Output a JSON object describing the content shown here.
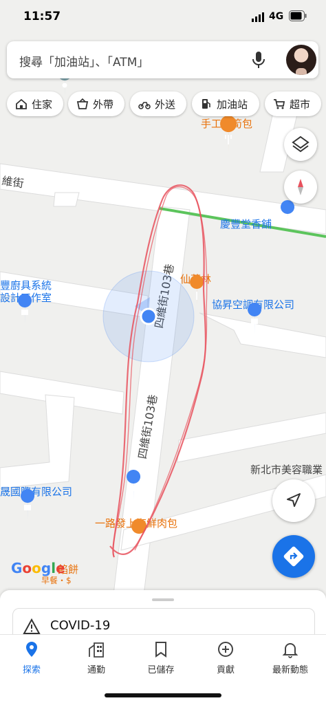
{
  "status_bar": {
    "time": "11:57",
    "network": "4G"
  },
  "search": {
    "placeholder": "搜尋「加油站」、「ATM」"
  },
  "chips": [
    {
      "label": "住家",
      "icon": "home-icon"
    },
    {
      "label": "外帶",
      "icon": "takeout-icon"
    },
    {
      "label": "外送",
      "icon": "delivery-icon"
    },
    {
      "label": "加油站",
      "icon": "gas-station-icon"
    },
    {
      "label": "超市",
      "icon": "cart-icon"
    }
  ],
  "map": {
    "street_labels": [
      "維街",
      "四維街103巷",
      "四維街103巷"
    ],
    "places": [
      {
        "name": "手工竹筍包",
        "color": "#e8710a"
      },
      {
        "name": "慶豐堂香舖",
        "color": "#1a73e8"
      },
      {
        "name": "仙草林",
        "color": "#e8710a"
      },
      {
        "name": "協昇空調有限公司",
        "color": "#1a73e8"
      },
      {
        "name": "豐廚具系統",
        "color": "#1a73e8"
      },
      {
        "name": "設計工作室",
        "color": "#1a73e8"
      },
      {
        "name": "新北市美容職業",
        "color": "#444444"
      },
      {
        "name": "晟國際有限公司",
        "color": "#1a73e8"
      },
      {
        "name": "一路發上海鮮肉包",
        "color": "#e8710a"
      },
      {
        "name": "餡餅",
        "color": "#e8710a"
      },
      {
        "name": "早餐・$",
        "color": "#e8710a"
      }
    ],
    "logo": "Google",
    "colors": {
      "road": "#ffffff",
      "land": "#f0f0ee",
      "green_road": "#5cc45c",
      "annotation": "#e8515d",
      "location": "#4285f4"
    }
  },
  "sheet": {
    "covid_label": "COVID-19"
  },
  "nav": [
    {
      "label": "探索",
      "icon": "explore-pin-icon",
      "active": true
    },
    {
      "label": "通勤",
      "icon": "commute-icon",
      "active": false
    },
    {
      "label": "已儲存",
      "icon": "bookmark-icon",
      "active": false
    },
    {
      "label": "貢獻",
      "icon": "contribute-plus-icon",
      "active": false
    },
    {
      "label": "最新動態",
      "icon": "bell-icon",
      "active": false
    }
  ]
}
